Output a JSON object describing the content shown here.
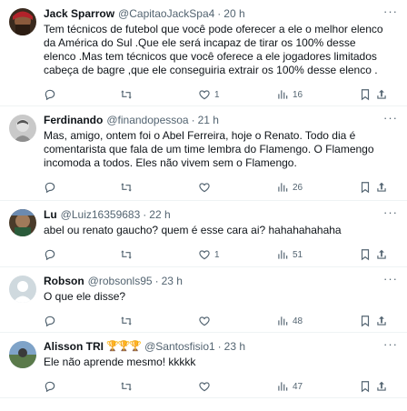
{
  "colors": {
    "text": "#0f1419",
    "muted": "#536471",
    "divider": "#eff3f4"
  },
  "icons": {
    "reply": "reply-icon",
    "retweet": "retweet-icon",
    "like": "heart-icon",
    "views": "views-icon",
    "bookmark": "bookmark-icon",
    "share": "share-icon",
    "more": "more-icon"
  },
  "tweets": [
    {
      "name": "Jack Sparrow",
      "handle": "@CapitaoJackSpa4",
      "time": "20 h",
      "text": "Tem técnicos de futebol que você pode oferecer a ele o melhor elenco da América do Sul .Que ele será incapaz de tirar os 100% desse elenco .Mas tem técnicos que você oferece a ele jogadores limitados cabeça de bagre ,que ele conseguiria extrair os 100% desse elenco .",
      "replies": "",
      "retweets": "",
      "likes": "1",
      "views": "16"
    },
    {
      "name": "Ferdinando",
      "handle": "@finandopessoa",
      "time": "21 h",
      "text": "Mas, amigo, ontem foi o Abel Ferreira, hoje o Renato. Todo dia é comentarista que fala de um time lembra do Flamengo. O Flamengo incomoda a todos. Eles não vivem sem o Flamengo.",
      "replies": "",
      "retweets": "",
      "likes": "",
      "views": "26"
    },
    {
      "name": "Lu",
      "handle": "@Luiz16359683",
      "time": "22 h",
      "text": "abel ou renato gaucho? quem é esse cara ai? hahahahahaha",
      "replies": "",
      "retweets": "",
      "likes": "1",
      "views": "51"
    },
    {
      "name": "Robson",
      "handle": "@robsonls95",
      "time": "23 h",
      "text": "O que ele disse?",
      "replies": "",
      "retweets": "",
      "likes": "",
      "views": "48"
    },
    {
      "name": "Alisson TRI",
      "name_emoji": "🏆🏆🏆",
      "handle": "@Santosfisio1",
      "time": "23 h",
      "text": "Ele não aprende mesmo! kkkkk",
      "replies": "",
      "retweets": "",
      "likes": "",
      "views": "47"
    }
  ]
}
